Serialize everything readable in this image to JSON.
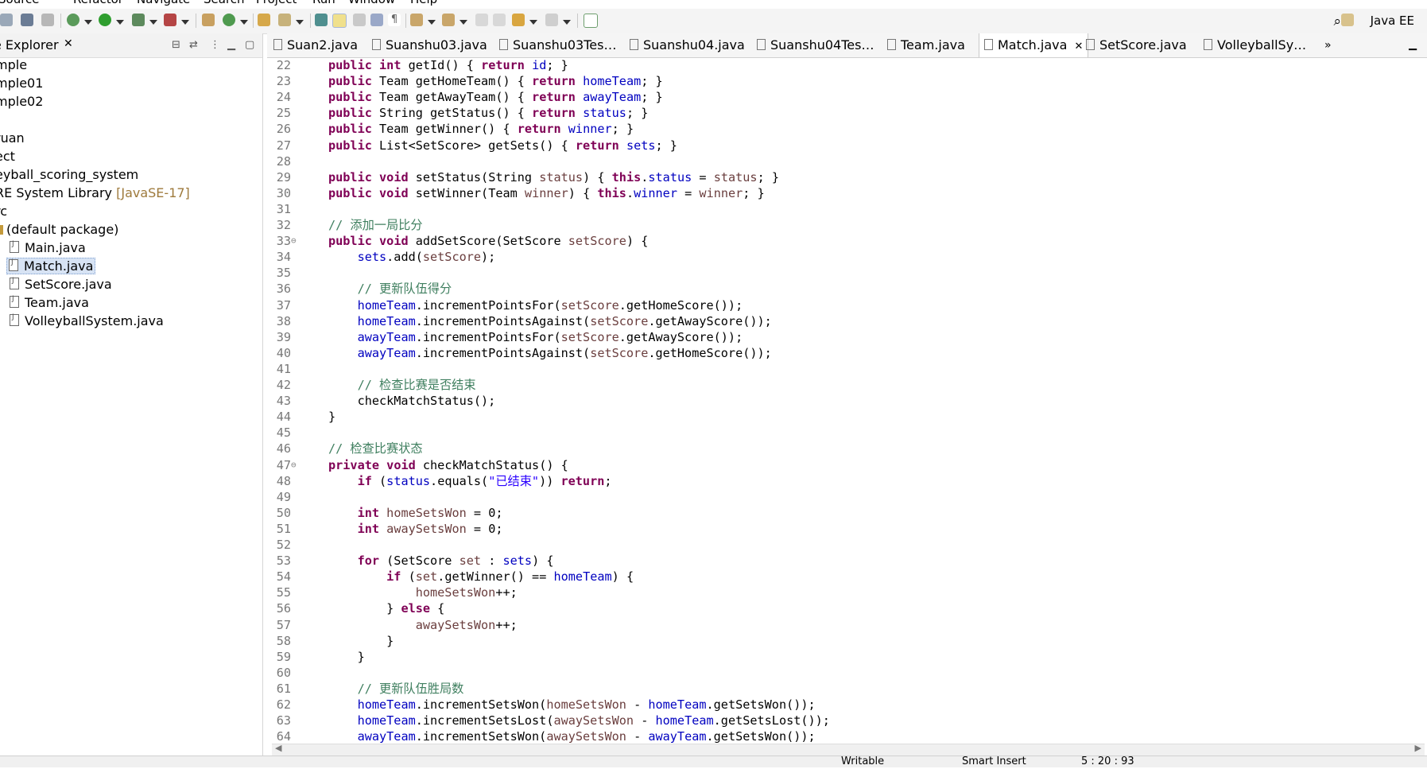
{
  "menu": [
    "Source",
    "Refactor",
    "Navigate",
    "Search",
    "Project",
    "Run",
    "Window",
    "Help"
  ],
  "perspective": "Java EE",
  "explorer": {
    "title": "e Explorer",
    "items": [
      "mple",
      "mple01",
      "mple02",
      "ruan",
      "ect",
      "eyball_scoring_system",
      "RE System Library",
      "[JavaSE-17]",
      "rc",
      "(default package)",
      "Main.java",
      "Match.java",
      "SetScore.java",
      "Team.java",
      "VolleyballSystem.java"
    ]
  },
  "tabs": [
    "Suan2.java",
    "Suanshu03.java",
    "Suanshu03Tes…",
    "Suanshu04.java",
    "Suanshu04Tes…",
    "Team.java",
    "Match.java",
    "SetScore.java",
    "VolleyballSy…"
  ],
  "tabs_more": "»",
  "status_bar": [
    "Writable",
    "Smart Insert",
    "5 : 20 : 93"
  ],
  "code_lines": [
    {
      "n": "22",
      "html": "<span class=\"kw\">public</span> <span class=\"kw\">int</span> getId() { <span class=\"kw\">return</span> <span class=\"fld\">id</span>; }"
    },
    {
      "n": "23",
      "html": "<span class=\"kw\">public</span> Team getHomeTeam() { <span class=\"kw\">return</span> <span class=\"fld\">homeTeam</span>; }"
    },
    {
      "n": "24",
      "html": "<span class=\"kw\">public</span> Team getAwayTeam() { <span class=\"kw\">return</span> <span class=\"fld\">awayTeam</span>; }"
    },
    {
      "n": "25",
      "html": "<span class=\"kw\">public</span> String getStatus() { <span class=\"kw\">return</span> <span class=\"fld\">status</span>; }"
    },
    {
      "n": "26",
      "html": "<span class=\"kw\">public</span> Team getWinner() { <span class=\"kw\">return</span> <span class=\"fld\">winner</span>; }"
    },
    {
      "n": "27",
      "html": "<span class=\"kw\">public</span> List&lt;SetScore&gt; getSets() { <span class=\"kw\">return</span> <span class=\"fld\">sets</span>; }"
    },
    {
      "n": "28",
      "html": ""
    },
    {
      "n": "29",
      "html": "<span class=\"kw\">public</span> <span class=\"kw\">void</span> setStatus(String <span class=\"var\">status</span>) { <span class=\"kw\">this</span>.<span class=\"fld\">status</span> = <span class=\"var\">status</span>; }"
    },
    {
      "n": "30",
      "html": "<span class=\"kw\">public</span> <span class=\"kw\">void</span> setWinner(Team <span class=\"var\">winner</span>) { <span class=\"kw\">this</span>.<span class=\"fld\">winner</span> = <span class=\"var\">winner</span>; }"
    },
    {
      "n": "31",
      "html": ""
    },
    {
      "n": "32",
      "html": "<span class=\"cmt\">// 添加一局比分</span>"
    },
    {
      "n": "33",
      "fold": true,
      "html": "<span class=\"kw\">public</span> <span class=\"kw\">void</span> addSetScore(SetScore <span class=\"var\">setScore</span>) {"
    },
    {
      "n": "34",
      "html": "    <span class=\"fld\">sets</span>.add(<span class=\"var\">setScore</span>);"
    },
    {
      "n": "35",
      "html": ""
    },
    {
      "n": "36",
      "html": "    <span class=\"cmt\">// 更新队伍得分</span>"
    },
    {
      "n": "37",
      "html": "    <span class=\"fld\">homeTeam</span>.incrementPointsFor(<span class=\"var\">setScore</span>.getHomeScore());"
    },
    {
      "n": "38",
      "html": "    <span class=\"fld\">homeTeam</span>.incrementPointsAgainst(<span class=\"var\">setScore</span>.getAwayScore());"
    },
    {
      "n": "39",
      "html": "    <span class=\"fld\">awayTeam</span>.incrementPointsFor(<span class=\"var\">setScore</span>.getAwayScore());"
    },
    {
      "n": "40",
      "html": "    <span class=\"fld\">awayTeam</span>.incrementPointsAgainst(<span class=\"var\">setScore</span>.getHomeScore());"
    },
    {
      "n": "41",
      "html": ""
    },
    {
      "n": "42",
      "html": "    <span class=\"cmt\">// 检查比赛是否结束</span>"
    },
    {
      "n": "43",
      "html": "    checkMatchStatus();"
    },
    {
      "n": "44",
      "html": "}"
    },
    {
      "n": "45",
      "html": ""
    },
    {
      "n": "46",
      "html": "<span class=\"cmt\">// 检查比赛状态</span>"
    },
    {
      "n": "47",
      "fold": true,
      "html": "<span class=\"kw\">private</span> <span class=\"kw\">void</span> checkMatchStatus() {"
    },
    {
      "n": "48",
      "html": "    <span class=\"kw\">if</span> (<span class=\"fld\">status</span>.equals(<span class=\"str\">\"已结束\"</span>)) <span class=\"kw\">return</span>;"
    },
    {
      "n": "49",
      "html": ""
    },
    {
      "n": "50",
      "html": "    <span class=\"kw\">int</span> <span class=\"var\">homeSetsWon</span> = 0;"
    },
    {
      "n": "51",
      "html": "    <span class=\"kw\">int</span> <span class=\"var\">awaySetsWon</span> = 0;"
    },
    {
      "n": "52",
      "html": ""
    },
    {
      "n": "53",
      "html": "    <span class=\"kw\">for</span> (SetScore <span class=\"var\">set</span> : <span class=\"fld\">sets</span>) {"
    },
    {
      "n": "54",
      "html": "        <span class=\"kw\">if</span> (<span class=\"var\">set</span>.getWinner() == <span class=\"fld\">homeTeam</span>) {"
    },
    {
      "n": "55",
      "html": "            <span class=\"var\">homeSetsWon</span>++;"
    },
    {
      "n": "56",
      "html": "        } <span class=\"kw\">else</span> {"
    },
    {
      "n": "57",
      "html": "            <span class=\"var\">awaySetsWon</span>++;"
    },
    {
      "n": "58",
      "html": "        }"
    },
    {
      "n": "59",
      "html": "    }"
    },
    {
      "n": "60",
      "html": ""
    },
    {
      "n": "61",
      "html": "    <span class=\"cmt\">// 更新队伍胜局数</span>"
    },
    {
      "n": "62",
      "html": "    <span class=\"fld\">homeTeam</span>.incrementSetsWon(<span class=\"var\">homeSetsWon</span> - <span class=\"fld\">homeTeam</span>.getSetsWon());"
    },
    {
      "n": "63",
      "html": "    <span class=\"fld\">homeTeam</span>.incrementSetsLost(<span class=\"var\">awaySetsWon</span> - <span class=\"fld\">homeTeam</span>.getSetsLost());"
    },
    {
      "n": "64",
      "html": "    <span class=\"fld\">awayTeam</span>.incrementSetsWon(<span class=\"var\">awaySetsWon</span> - <span class=\"fld\">awayTeam</span>.getSetsWon());"
    }
  ]
}
